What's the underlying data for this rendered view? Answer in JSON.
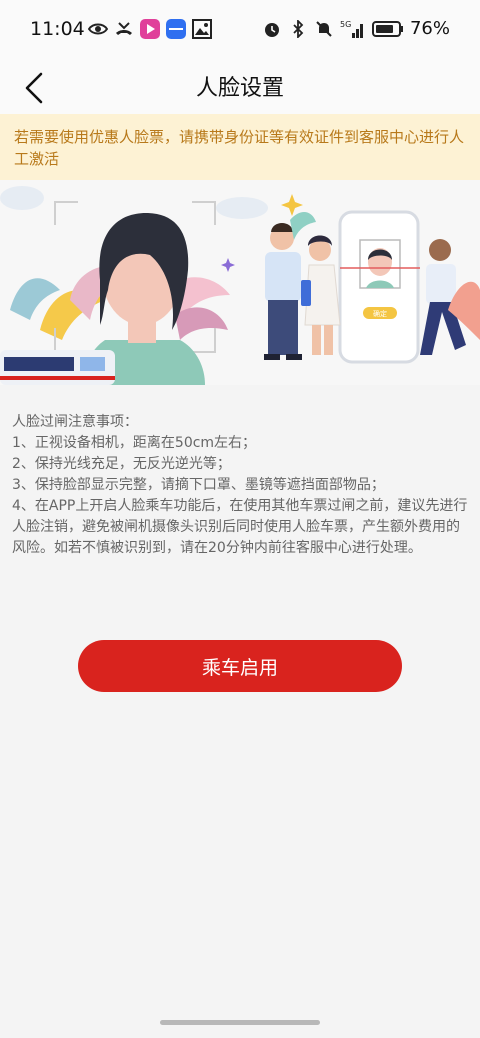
{
  "status_bar": {
    "time": "11:04",
    "battery_percent": "76%",
    "network": "5G",
    "icons_left": [
      "eye-icon",
      "missed-call-icon",
      "video-app-icon",
      "honor-app-icon",
      "gallery-icon"
    ],
    "icons_right": [
      "alarm-icon",
      "bluetooth-icon",
      "mute-icon",
      "signal-icon",
      "battery-icon"
    ]
  },
  "nav": {
    "title": "人脸设置",
    "back_icon": "chevron-left-icon"
  },
  "notice": {
    "text": "若需要使用优惠人脸票，请携带身份证等有效证件到客服中心进行人工激活",
    "color": "#b8791a",
    "background": "#fdf2d4"
  },
  "illustration": {
    "phone_button_label": "确定"
  },
  "instructions": {
    "heading": "人脸过闸注意事项：",
    "items": [
      "1、正视设备相机，距离在50cm左右；",
      "2、保持光线充足，无反光逆光等；",
      "3、保持脸部显示完整，请摘下口罩、墨镜等遮挡面部物品；",
      "4、在APP上开启人脸乘车功能后，在使用其他车票过闸之前，建议先进行人脸注销，避免被闸机摄像头识别后同时使用人脸车票，产生额外费用的风险。如若不慎被识别到，请在20分钟内前往客服中心进行处理。"
    ]
  },
  "actions": {
    "enable_label": "乘车启用",
    "accent_color": "#d9231e"
  }
}
